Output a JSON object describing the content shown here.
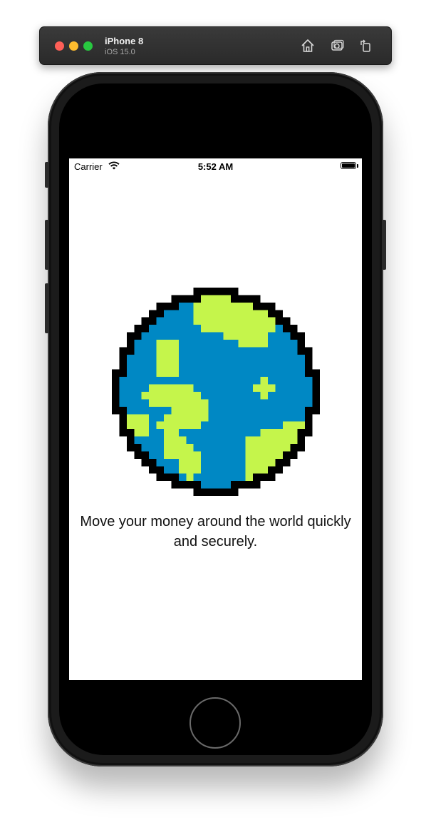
{
  "simulator": {
    "device_name": "iPhone 8",
    "os_version": "iOS 15.0",
    "toolbar_icons": [
      "home-icon",
      "screenshot-icon",
      "rotate-icon"
    ]
  },
  "status_bar": {
    "carrier": "Carrier",
    "time": "5:52 AM"
  },
  "onboarding": {
    "illustration": "pixel-globe-icon",
    "message": "Move your money around the world quickly and securely."
  },
  "colors": {
    "ocean": "#0088c4",
    "land": "#c5f54b",
    "outline": "#000000"
  }
}
